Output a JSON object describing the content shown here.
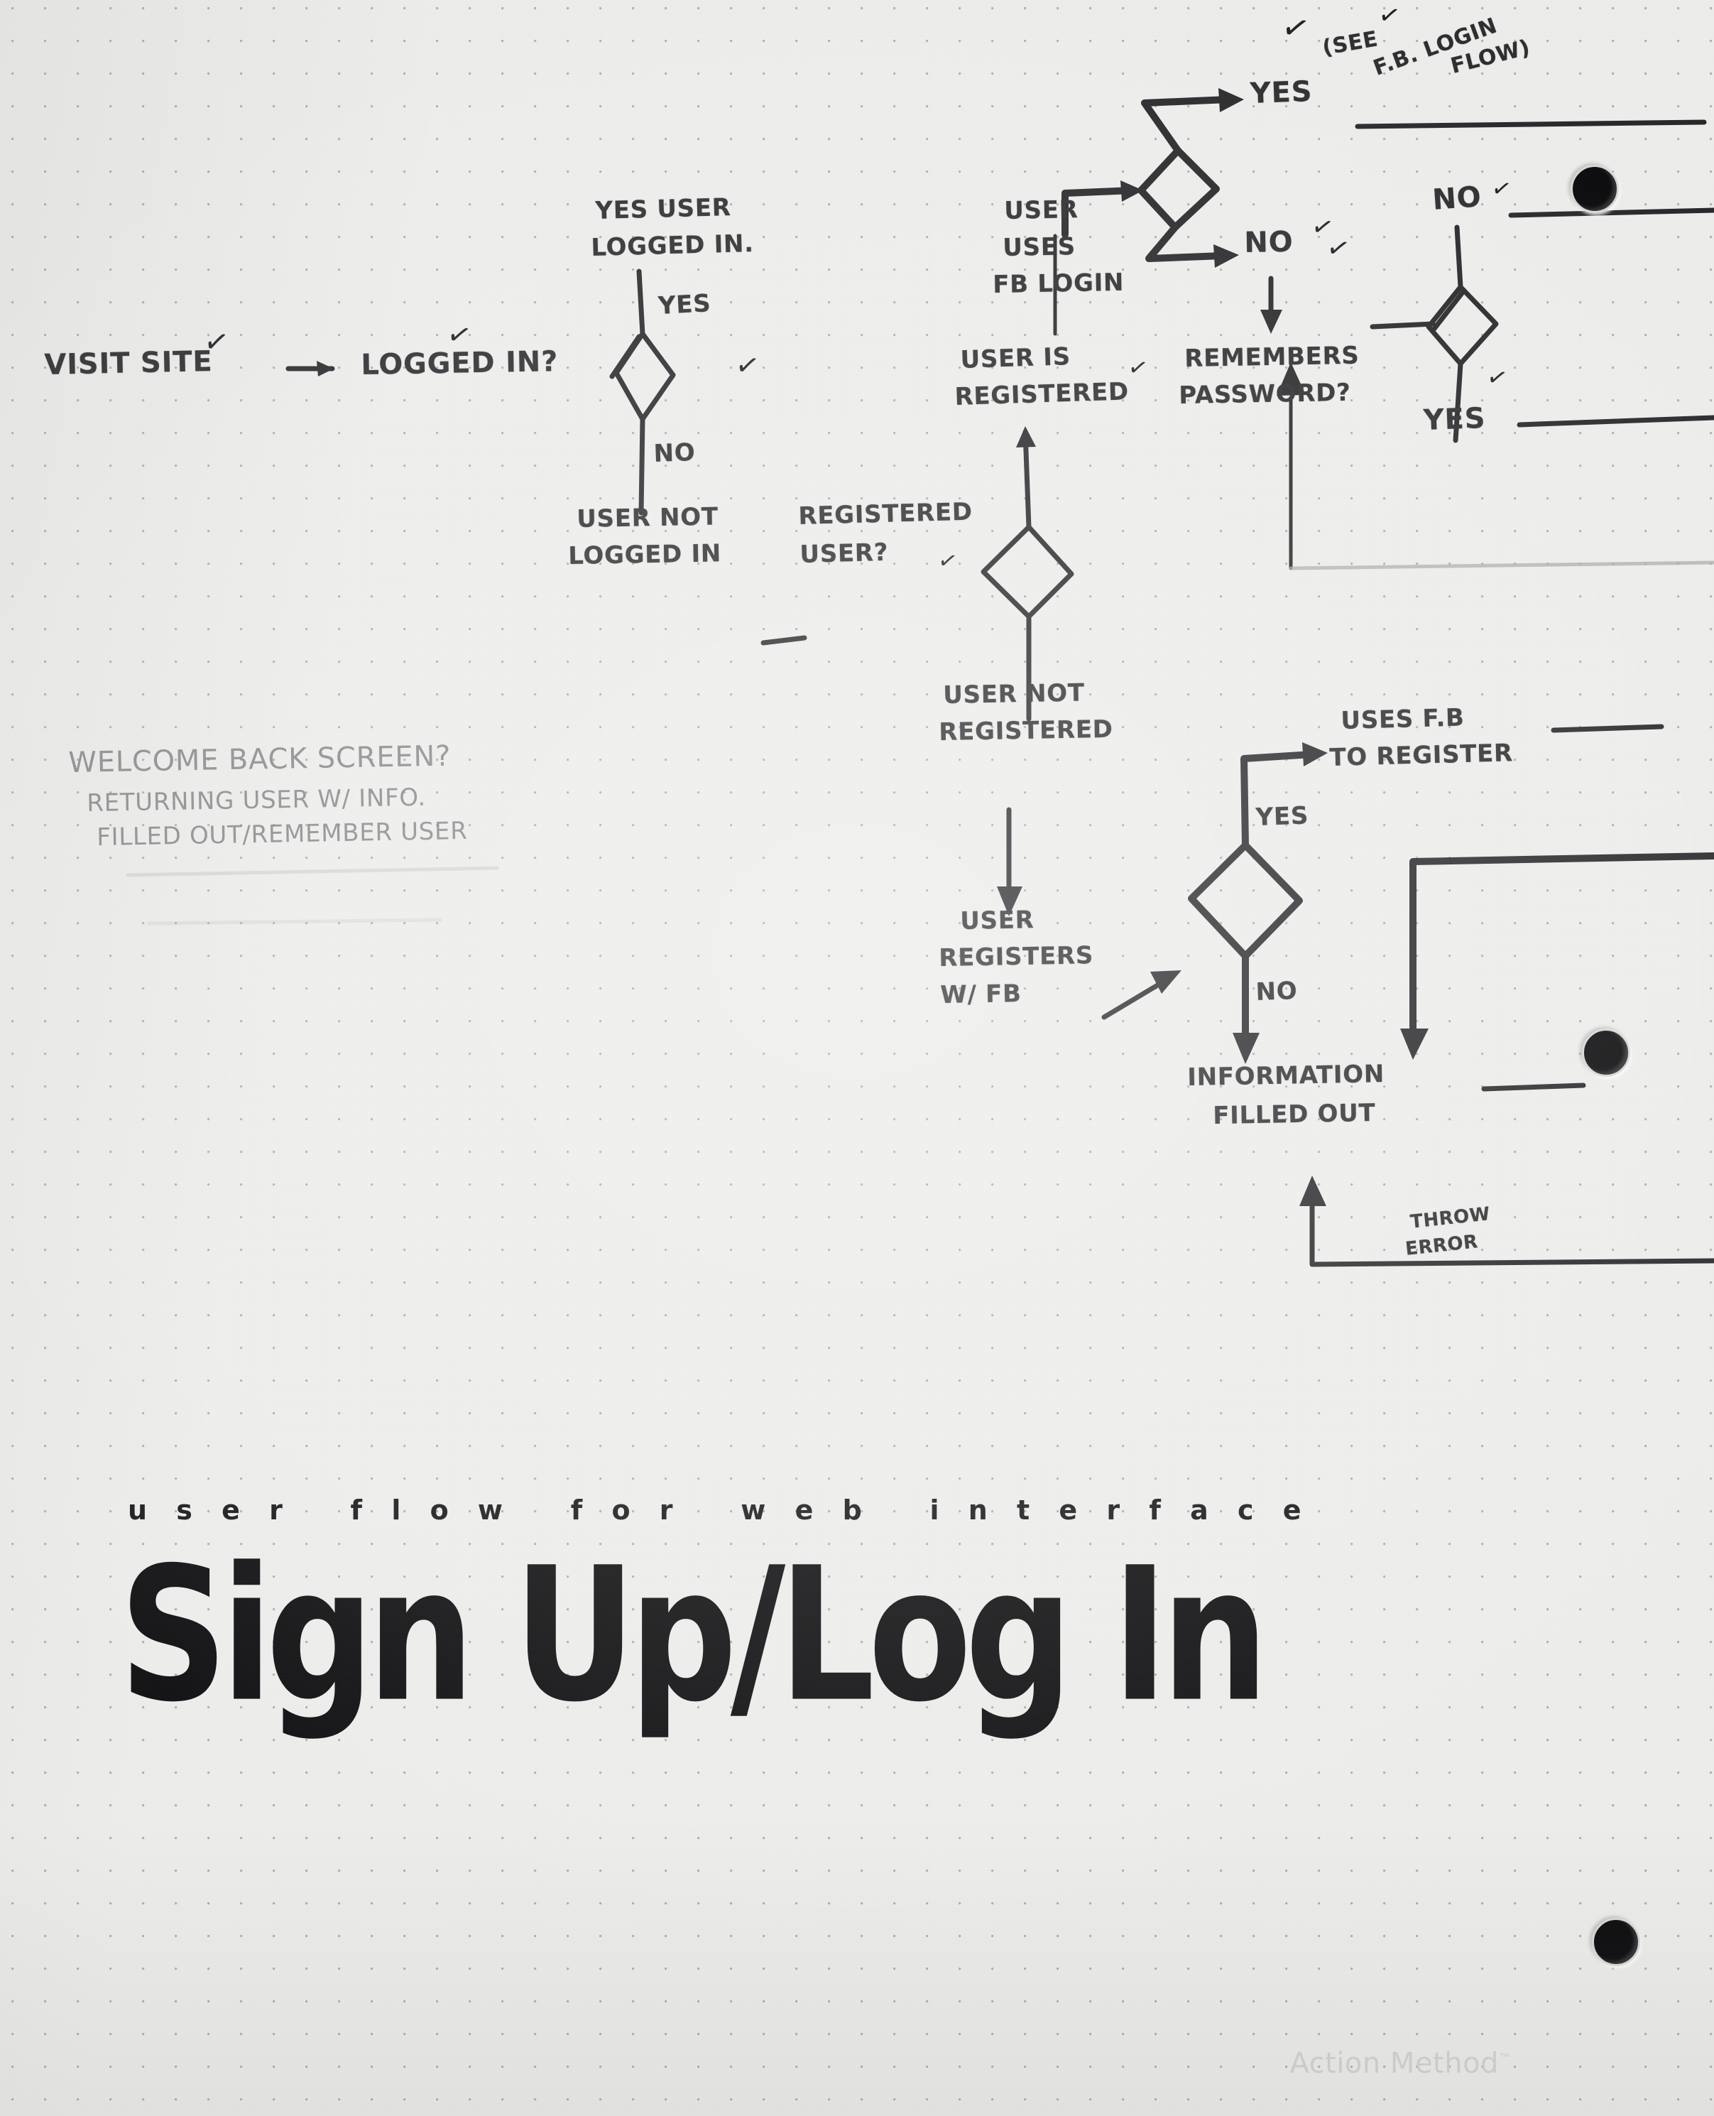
{
  "sheet": {
    "paper_color": "#eeeeec",
    "dot_color": "#787a7d",
    "ink_color": "#262629"
  },
  "title": {
    "subtitle": "u s e r   f l o w   f o r   w e b   i n t e r f a c e",
    "main": "Sign Up/Log In"
  },
  "watermark": {
    "brand": "Action Method",
    "tm": "™"
  },
  "chart_data": {
    "type": "diagram",
    "title": "Sign Up/Log In",
    "subtitle": "user flow for web interface",
    "notation": "hand-drawn flowchart, diamonds = decisions, arrows = flow, check marks = reviewed",
    "nodes": [
      {
        "id": "visit_site",
        "label": "VISIT SITE",
        "shape": "text"
      },
      {
        "id": "logged_in_q",
        "label": "LOGGED IN?",
        "shape": "decision"
      },
      {
        "id": "yes_user_logged_in",
        "label": "YES USER LOGGED IN",
        "shape": "text"
      },
      {
        "id": "user_not_logged_in",
        "label": "USER NOT LOGGED IN",
        "shape": "text"
      },
      {
        "id": "registered_user_q",
        "label": "REGISTERED USER?",
        "shape": "decision"
      },
      {
        "id": "user_is_registered",
        "label": "USER IS REGISTERED",
        "shape": "text"
      },
      {
        "id": "user_not_registered",
        "label": "USER NOT REGISTERED",
        "shape": "text"
      },
      {
        "id": "user_uses_fb_login",
        "label": "USER USES FB LOGIN",
        "shape": "text"
      },
      {
        "id": "fb_login_q",
        "label": "",
        "shape": "decision"
      },
      {
        "id": "see_fb_login_flow",
        "label": "(SEE F.B. LOGIN FLOW)",
        "shape": "note"
      },
      {
        "id": "remembers_pw_q",
        "label": "REMEMBERS PASSWORD?",
        "shape": "decision"
      },
      {
        "id": "user_registers_fb",
        "label": "USER REGISTERS W/ FB",
        "shape": "text"
      },
      {
        "id": "register_fb_q",
        "label": "",
        "shape": "decision"
      },
      {
        "id": "uses_fb_to_register",
        "label": "USES F.B. TO REGISTER",
        "shape": "text"
      },
      {
        "id": "information_filled",
        "label": "INFORMATION FILLED OUT",
        "shape": "text"
      },
      {
        "id": "throw_error",
        "label": "THROW ERROR",
        "shape": "text"
      },
      {
        "id": "welcome_back",
        "label": "WELCOME BACK SCREEN?",
        "shape": "note"
      }
    ],
    "edges": [
      {
        "from": "visit_site",
        "to": "logged_in_q",
        "label": ""
      },
      {
        "from": "logged_in_q",
        "to": "yes_user_logged_in",
        "label": "YES"
      },
      {
        "from": "logged_in_q",
        "to": "user_not_logged_in",
        "label": "NO"
      },
      {
        "from": "user_not_logged_in",
        "to": "registered_user_q",
        "label": ""
      },
      {
        "from": "registered_user_q",
        "to": "user_is_registered",
        "label": ""
      },
      {
        "from": "registered_user_q",
        "to": "user_not_registered",
        "label": ""
      },
      {
        "from": "user_uses_fb_login",
        "to": "fb_login_q",
        "label": ""
      },
      {
        "from": "fb_login_q",
        "to": "see_fb_login_flow",
        "label": "YES"
      },
      {
        "from": "fb_login_q",
        "to": "remembers_pw_q",
        "label": "NO"
      },
      {
        "from": "remembers_pw_q",
        "to": "no_branch",
        "label": "NO"
      },
      {
        "from": "remembers_pw_q",
        "to": "yes_branch",
        "label": "YES"
      },
      {
        "from": "user_not_registered",
        "to": "user_registers_fb",
        "label": ""
      },
      {
        "from": "user_registers_fb",
        "to": "register_fb_q",
        "label": ""
      },
      {
        "from": "register_fb_q",
        "to": "uses_fb_to_register",
        "label": "YES"
      },
      {
        "from": "register_fb_q",
        "to": "information_filled",
        "label": "NO"
      },
      {
        "from": "throw_error",
        "to": "information_filled",
        "label": ""
      }
    ]
  },
  "labels": {
    "visit_site": "VISIT SITE",
    "logged_in_q": "LOGGED IN?",
    "yes_user_logged_in_l1": "YES USER",
    "yes_user_logged_in_l2": "LOGGED IN.",
    "yes": "YES",
    "no": "NO",
    "user_not_logged_in_l1": "USER NOT",
    "user_not_logged_in_l2": "LOGGED IN",
    "registered_user_l1": "REGISTERED",
    "registered_user_l2": "USER?",
    "user_is_registered_l1": "USER IS",
    "user_is_registered_l2": "REGISTERED",
    "user_uses_fb_l1": "USER",
    "user_uses_fb_l2": "USES",
    "user_uses_fb_l3": "FB LOGIN",
    "fb_yes": "YES",
    "fb_no": "NO",
    "see_fb_flow_l1": "(SEE",
    "see_fb_flow_l2": "F.B. LOGIN",
    "see_fb_flow_l3": "FLOW)",
    "remembers_pw_l1": "REMEMBERS",
    "remembers_pw_l2": "PASSWORD?",
    "pw_no": "NO",
    "pw_yes": "YES",
    "user_not_registered_l1": "USER NOT",
    "user_not_registered_l2": "REGISTERED",
    "user_registers_fb_l1": "USER",
    "user_registers_fb_l2": "REGISTERS",
    "user_registers_fb_l3": "W/ FB",
    "reg_yes": "YES",
    "reg_no": "NO",
    "uses_fb_register_l1": "USES F.B",
    "uses_fb_register_l2": "TO REGISTER",
    "information_filled_l1": "INFORMATION",
    "information_filled_l2": "FILLED OUT",
    "throw_error_l1": "THROW",
    "throw_error_l2": "ERROR",
    "welcome_back_l1": "WELCOME BACK SCREEN?",
    "welcome_back_l2": "RETURNING USER W/ INFO.",
    "welcome_back_l3": "FILLED OUT/REMEMBER USER",
    "check": "✓"
  }
}
